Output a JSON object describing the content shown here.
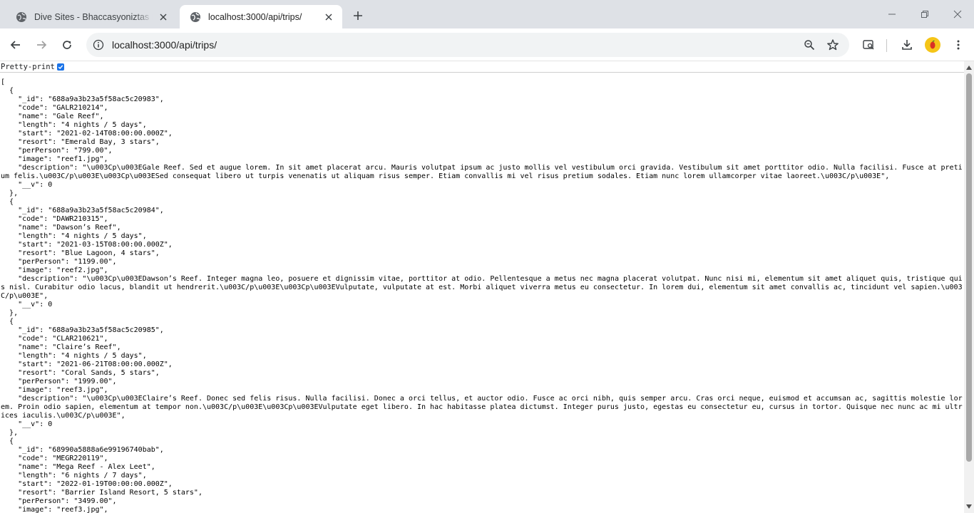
{
  "tabs": [
    {
      "title": "Dive Sites - Bhaccasyoniztas Beach Resort",
      "active": false
    },
    {
      "title": "localhost:3000/api/trips/",
      "active": true
    }
  ],
  "toolbar": {
    "url": "localhost:3000/api/trips/"
  },
  "viewer": {
    "pretty_print_label": "Pretty-print",
    "pretty_print_checked": true
  },
  "json_lines": [
    "[",
    "  {",
    "    \"_id\": \"688a9a3b23a5f58ac5c20983\",",
    "    \"code\": \"GALR210214\",",
    "    \"name\": \"Gale Reef\",",
    "    \"length\": \"4 nights / 5 days\",",
    "    \"start\": \"2021-02-14T08:00:00.000Z\",",
    "    \"resort\": \"Emerald Bay, 3 stars\",",
    "    \"perPerson\": \"799.00\",",
    "    \"image\": \"reef1.jpg\",",
    "    \"description\": \"\\u003Cp\\u003EGale Reef. Sed et augue lorem. In sit amet placerat arcu. Mauris volutpat ipsum ac justo mollis vel vestibulum orci gravida. Vestibulum sit amet porttitor odio. Nulla facilisi. Fusce at pretium felis.\\u003C/p\\u003E\\u003Cp\\u003ESed consequat libero ut turpis venenatis ut aliquam risus semper. Etiam convallis mi vel risus pretium sodales. Etiam nunc lorem ullamcorper vitae laoreet.\\u003C/p\\u003E\",",
    "    \"__v\": 0",
    "  },",
    "  {",
    "    \"_id\": \"688a9a3b23a5f58ac5c20984\",",
    "    \"code\": \"DAWR210315\",",
    "    \"name\": \"Dawson’s Reef\",",
    "    \"length\": \"4 nights / 5 days\",",
    "    \"start\": \"2021-03-15T08:00:00.000Z\",",
    "    \"resort\": \"Blue Lagoon, 4 stars\",",
    "    \"perPerson\": \"1199.00\",",
    "    \"image\": \"reef2.jpg\",",
    "    \"description\": \"\\u003Cp\\u003EDawson’s Reef. Integer magna leo, posuere et dignissim vitae, porttitor at odio. Pellentesque a metus nec magna placerat volutpat. Nunc nisi mi, elementum sit amet aliquet quis, tristique quis nisl. Curabitur odio lacus, blandit ut hendrerit.\\u003C/p\\u003E\\u003Cp\\u003EVulputate, vulputate at est. Morbi aliquet viverra metus eu consectetur. In lorem dui, elementum sit amet convallis ac, tincidunt vel sapien.\\u003C/p\\u003E\",",
    "    \"__v\": 0",
    "  },",
    "  {",
    "    \"_id\": \"688a9a3b23a5f58ac5c20985\",",
    "    \"code\": \"CLAR210621\",",
    "    \"name\": \"Claire’s Reef\",",
    "    \"length\": \"4 nights / 5 days\",",
    "    \"start\": \"2021-06-21T08:00:00.000Z\",",
    "    \"resort\": \"Coral Sands, 5 stars\",",
    "    \"perPerson\": \"1999.00\",",
    "    \"image\": \"reef3.jpg\",",
    "    \"description\": \"\\u003Cp\\u003EClaire’s Reef. Donec sed felis risus. Nulla facilisi. Donec a orci tellus, et auctor odio. Fusce ac orci nibh, quis semper arcu. Cras orci neque, euismod et accumsan ac, sagittis molestie lorem. Proin odio sapien, elementum at tempor non.\\u003C/p\\u003E\\u003Cp\\u003EVulputate eget libero. In hac habitasse platea dictumst. Integer purus justo, egestas eu consectetur eu, cursus in tortor. Quisque nec nunc ac mi ultrices iaculis.\\u003C/p\\u003E\",",
    "    \"__v\": 0",
    "  },",
    "  {",
    "    \"_id\": \"68990a5888a6e99196740bab\",",
    "    \"code\": \"MEGR220119\",",
    "    \"name\": \"Mega Reef - Alex Leet\",",
    "    \"length\": \"6 nights / 7 days\",",
    "    \"start\": \"2022-01-19T00:00:00.000Z\",",
    "    \"resort\": \"Barrier Island Resort, 5 stars\",",
    "    \"perPerson\": \"3499.00\",",
    "    \"image\": \"reef3.jpg\","
  ]
}
